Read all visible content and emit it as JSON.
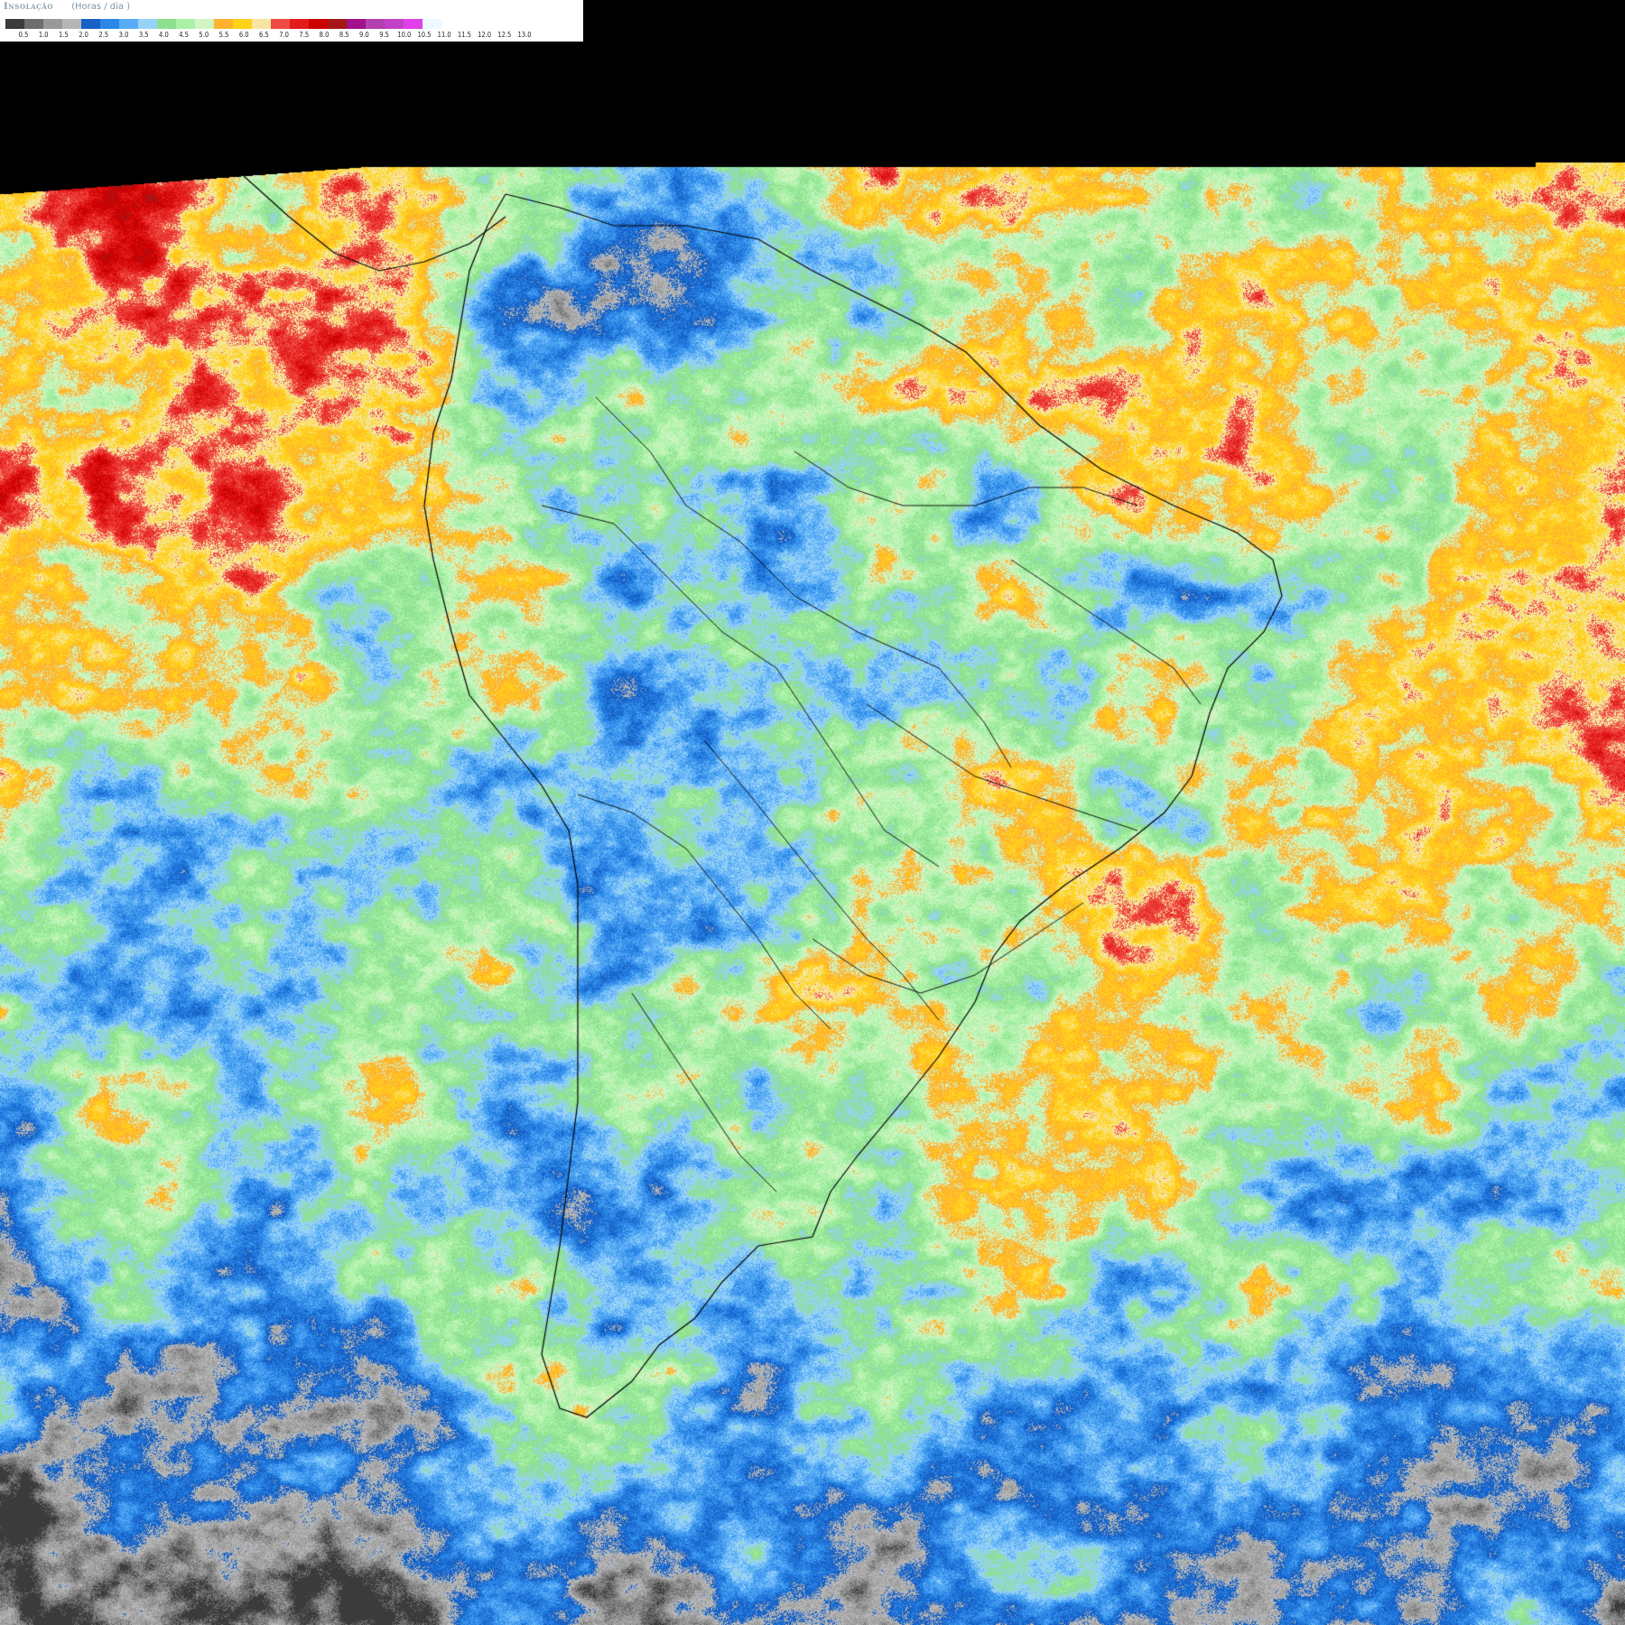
{
  "legend": {
    "title": "Insolação",
    "unit": "(Horas / dia )",
    "colors": [
      "#3b3b3b",
      "#6e6e6e",
      "#999999",
      "#b6b6b6",
      "#1561c6",
      "#2b86e6",
      "#58acf5",
      "#97d2fa",
      "#8de08e",
      "#a8f1a6",
      "#d0f5c3",
      "#ffb32d",
      "#ffd21a",
      "#f6e6a0",
      "#ef4a43",
      "#e21a1a",
      "#cd0000",
      "#a51717",
      "#a1118c",
      "#b240b0",
      "#c240c8",
      "#e040e8",
      "#eef8ff",
      "#ffffff"
    ],
    "ticks": [
      "0.5",
      "1.0",
      "1.5",
      "2.0",
      "2.5",
      "3.0",
      "3.5",
      "4.0",
      "4.5",
      "5.0",
      "5.5",
      "6.0",
      "6.5",
      "7.0",
      "7.5",
      "8.0",
      "8.5",
      "9.0",
      "9.5",
      "10.0",
      "10.5",
      "11.0",
      "11.5",
      "12.0",
      "12.5",
      "13.0"
    ]
  },
  "map": {
    "description_icon": "satellite-insolation-map"
  }
}
